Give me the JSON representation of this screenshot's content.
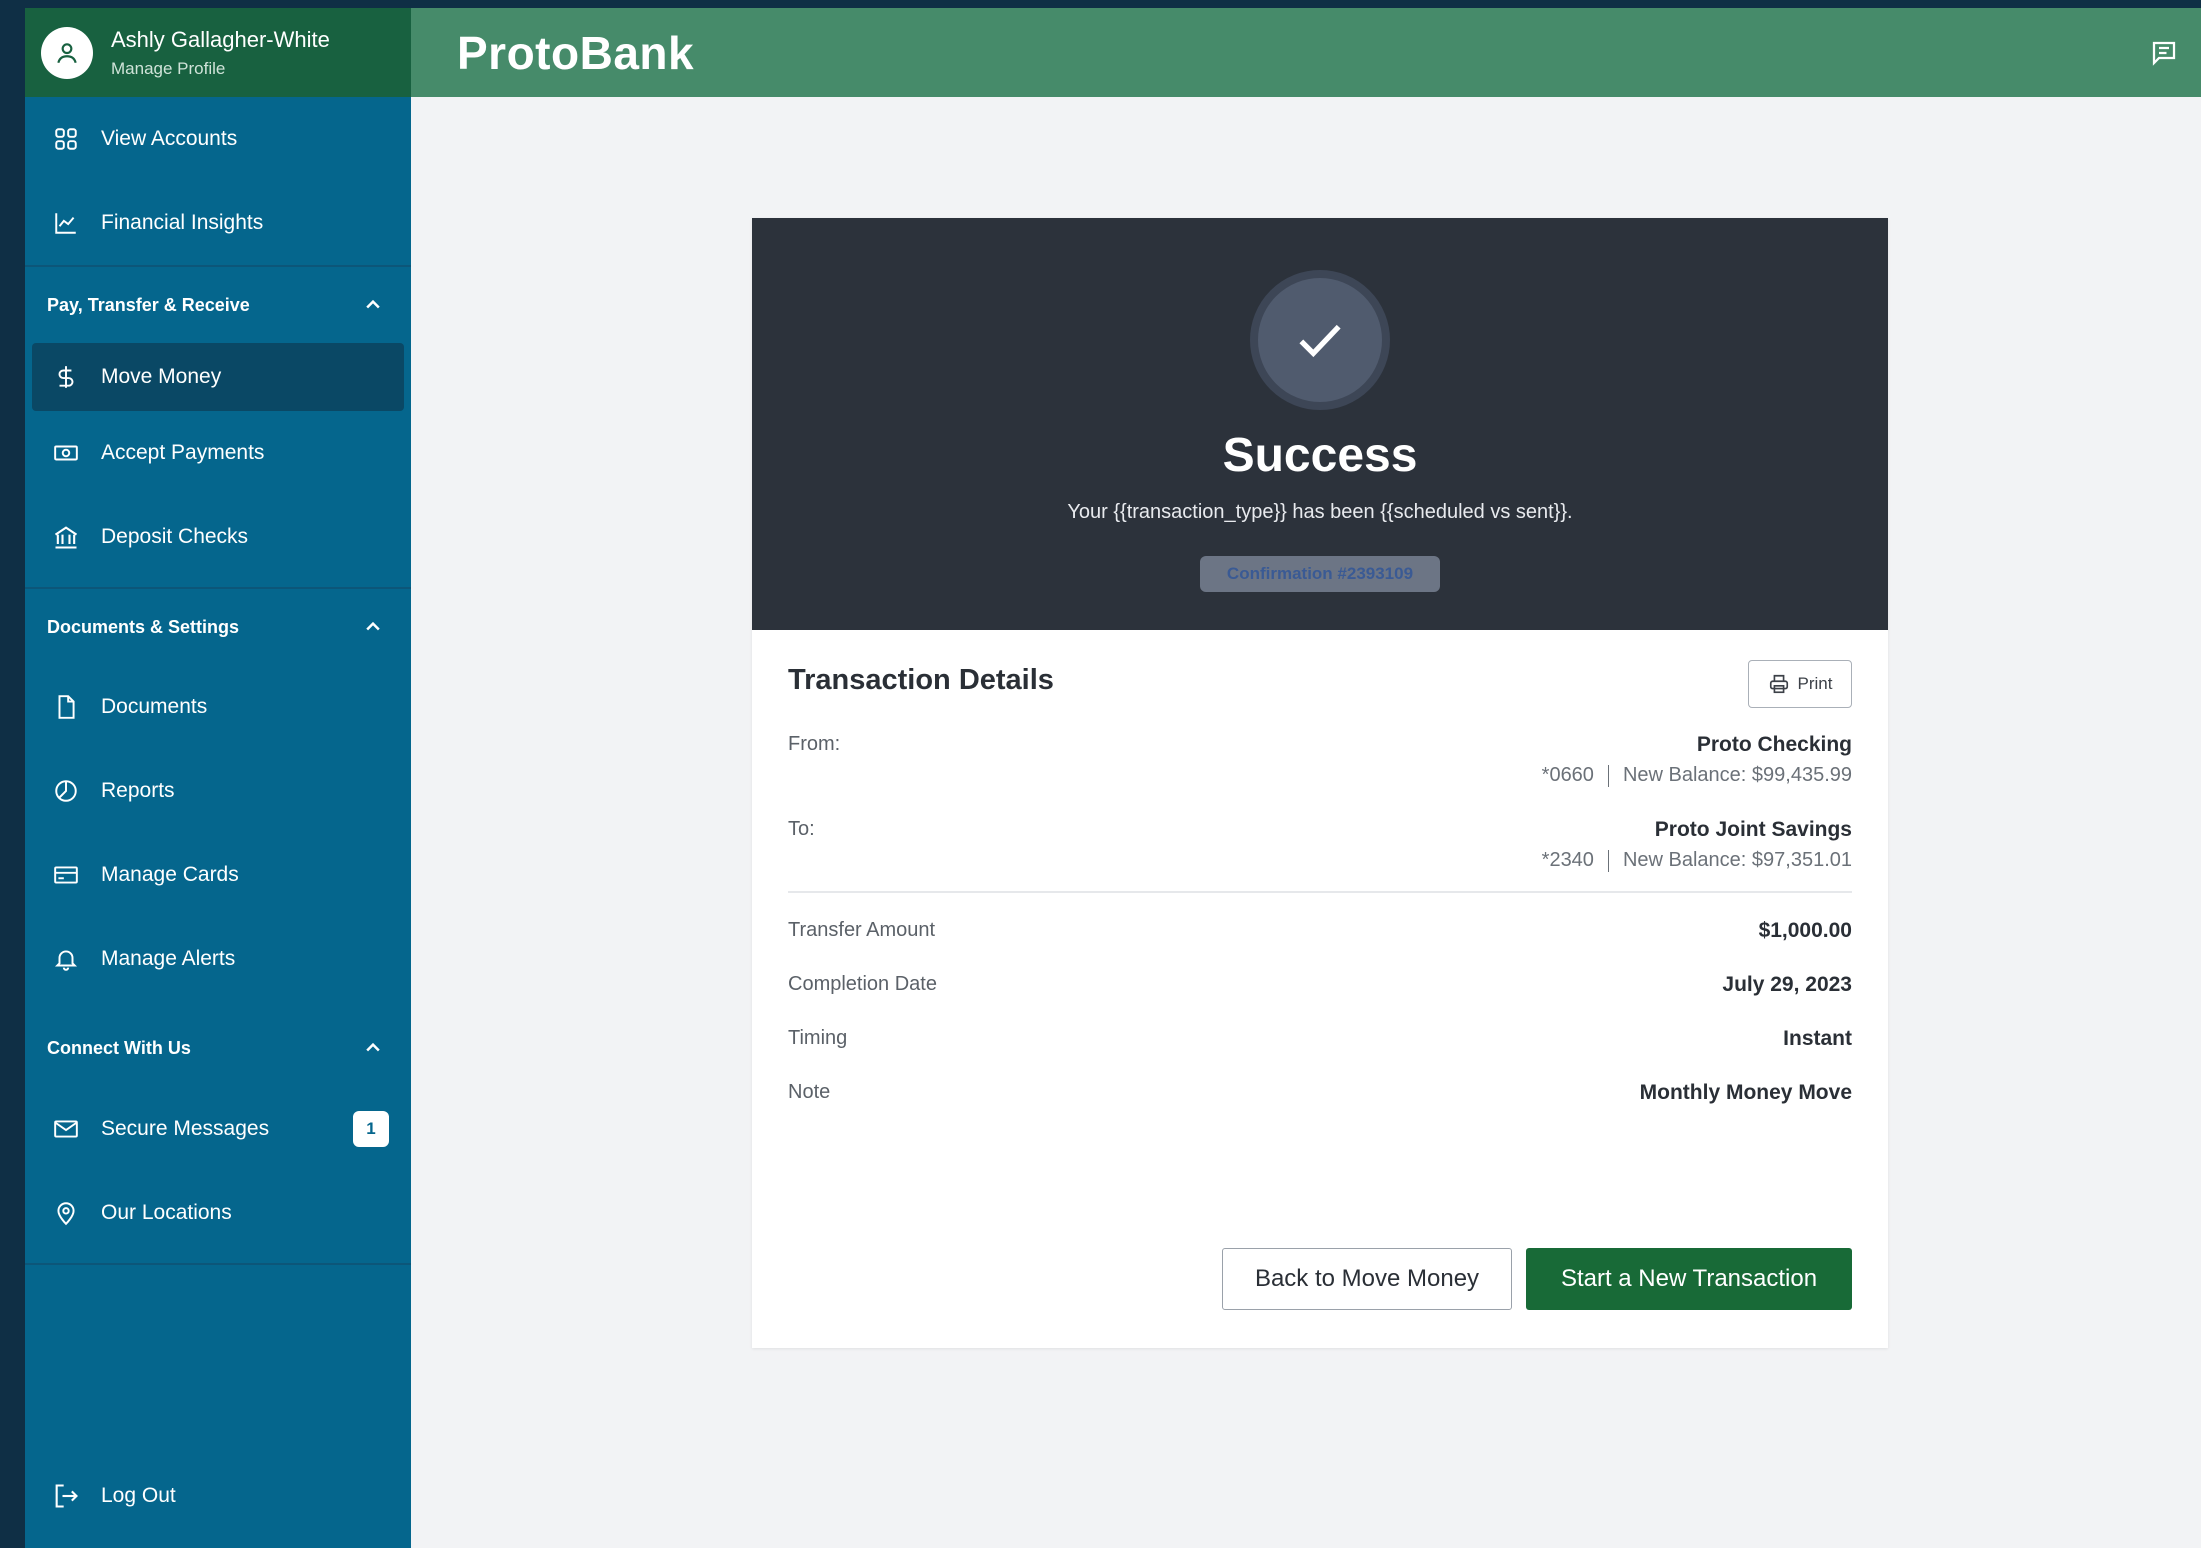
{
  "user": {
    "name": "Ashly Gallagher-White",
    "subtitle": "Manage Profile"
  },
  "brand": "ProtoBank",
  "sidebar": {
    "top_items": [
      {
        "label": "View Accounts",
        "icon": "grid-icon"
      },
      {
        "label": "Financial Insights",
        "icon": "chart-icon"
      }
    ],
    "sections": [
      {
        "title": "Pay, Transfer & Receive",
        "items": [
          {
            "label": "Move Money",
            "icon": "dollar-icon",
            "active": true
          },
          {
            "label": "Accept Payments",
            "icon": "cash-icon"
          },
          {
            "label": "Deposit Checks",
            "icon": "bank-icon"
          }
        ]
      },
      {
        "title": "Documents & Settings",
        "items": [
          {
            "label": "Documents",
            "icon": "document-icon"
          },
          {
            "label": "Reports",
            "icon": "pie-icon"
          },
          {
            "label": "Manage Cards",
            "icon": "card-icon"
          },
          {
            "label": "Manage Alerts",
            "icon": "bell-icon"
          }
        ]
      },
      {
        "title": "Connect With Us",
        "items": [
          {
            "label": "Secure Messages",
            "icon": "mail-icon",
            "badge": "1"
          },
          {
            "label": "Our Locations",
            "icon": "pin-icon"
          }
        ]
      }
    ],
    "logout": "Log Out"
  },
  "success": {
    "title": "Success",
    "message": "Your {{transaction_type}} has been {{scheduled vs sent}}.",
    "confirmation": "Confirmation #2393109"
  },
  "details": {
    "title": "Transaction Details",
    "print_label": "Print",
    "from": {
      "label": "From:",
      "account": "Proto Checking",
      "number": "*0660",
      "balance": "New Balance: $99,435.99"
    },
    "to": {
      "label": "To:",
      "account": "Proto Joint Savings",
      "number": "*2340",
      "balance": "New Balance: $97,351.01"
    },
    "rows": [
      {
        "label": "Transfer Amount",
        "value": "$1,000.00"
      },
      {
        "label": "Completion Date",
        "value": "July 29, 2023"
      },
      {
        "label": "Timing",
        "value": "Instant"
      },
      {
        "label": "Note",
        "value": "Monthly Money Move"
      }
    ]
  },
  "actions": {
    "back": "Back to Move Money",
    "new": "Start a New Transaction"
  },
  "colors": {
    "sidebar": "#05668d",
    "header": "#468b6a",
    "profile": "#186140",
    "primary": "#186a37",
    "panel": "#2c323b"
  }
}
